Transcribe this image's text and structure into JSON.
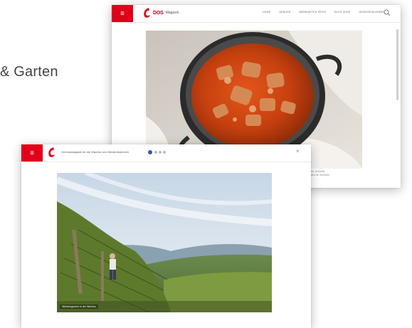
{
  "background": {
    "text": "& Garten"
  },
  "back_window": {
    "logo_text": "DOS",
    "logo_sub": "Magazin",
    "nav_items": [
      "HOME",
      "GENUSS",
      "WEINKARTEN REISE",
      "BLOG ZONE",
      "GENUSSKALENDER"
    ],
    "caption_lines": [
      "Rezepte, Kulinarik,",
      "und mehr für Genießer"
    ]
  },
  "front_window": {
    "title": "Genussmagazin für die Wachau und Niederösterreich",
    "photo_caption": "Weinbergszene in der Wachau"
  },
  "colors": {
    "brand_red": "#e1001a"
  }
}
